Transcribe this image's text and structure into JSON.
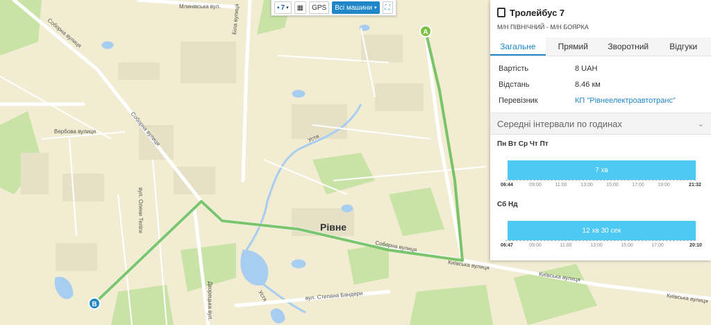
{
  "toolbar": {
    "route_number": "7",
    "gps_label": "GPS",
    "vehicles_label": "Всі машини"
  },
  "map": {
    "city_label": "Рівне",
    "marker_start": "A",
    "marker_end": "B",
    "route_color": "#6cbf5d",
    "streets": [
      "Млинівська вул.",
      "Соборна вулиця",
      "Вербова вулиця",
      "Соборна вулиця",
      "вул. Олени Теліги",
      "Біла вулиця",
      "Соборна вулиця",
      "Київська вулиця",
      "Київська вулиця",
      "Київська вулиця",
      "вул. Степана Бандери",
      "Дворецька вул.",
      "Устя",
      "Устя"
    ]
  },
  "panel": {
    "title": "Тролейбус 7",
    "subtitle": "М/Н ПІВНІЧНИЙ - М/Н БОЯРКА",
    "tabs": [
      "Загальне",
      "Прямий",
      "Зворотний",
      "Відгуки"
    ],
    "info": [
      {
        "key": "Вартість",
        "value": "8 UAH"
      },
      {
        "key": "Відстань",
        "value": "8.46 км"
      },
      {
        "key": "Перевізник",
        "value": "КП \"Рівнеелектроавтотранс\""
      }
    ],
    "intervals_title": "Середні інтервали по годинах",
    "weekdays": {
      "days_label": "Пн Вт Ср Чт Пт",
      "interval": "7 хв",
      "start": "06:44",
      "end": "21:32",
      "ticks": [
        "09:00",
        "11:00",
        "13:00",
        "15:00",
        "17:00",
        "19:00"
      ]
    },
    "weekend": {
      "days_label": "Сб Нд",
      "interval": "12 хв 30 сек",
      "start": "06:47",
      "end": "20:10",
      "ticks": [
        "09:00",
        "11:00",
        "13:00",
        "15:00",
        "17:00"
      ]
    }
  }
}
